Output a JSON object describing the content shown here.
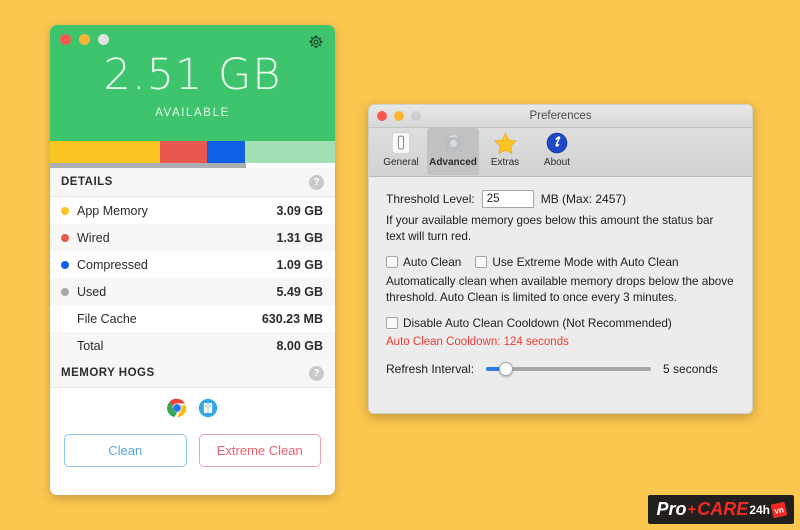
{
  "background_color": "#fbc74f",
  "memory_app": {
    "window_controls": [
      {
        "name": "close",
        "color": "#f9584f"
      },
      {
        "name": "minimize",
        "color": "#f8b633"
      },
      {
        "name": "zoom",
        "color": "#dfe2e0"
      }
    ],
    "settings_icon": "gear-icon",
    "header_bg": "#3ec46d",
    "available_value": "2.51 GB",
    "available_label": "AVAILABLE",
    "memory_bar": [
      {
        "name": "App Memory",
        "color": "#fac422",
        "percent": 38.6
      },
      {
        "name": "Wired",
        "color": "#e8584f",
        "percent": 16.4
      },
      {
        "name": "Compressed",
        "color": "#1161e8",
        "percent": 13.6
      },
      {
        "name": "Free",
        "color": "#a4e0b5",
        "percent": 31.4
      }
    ],
    "details_section": {
      "title": "DETAILS",
      "help_label": "?",
      "rows": [
        {
          "label": "App Memory",
          "value": "3.09 GB",
          "dot_color": "#fac422"
        },
        {
          "label": "Wired",
          "value": "1.31 GB",
          "dot_color": "#e8584f"
        },
        {
          "label": "Compressed",
          "value": "1.09 GB",
          "dot_color": "#1161e8"
        },
        {
          "label": "Used",
          "value": "5.49 GB",
          "dot_color": "#a8a8a8"
        },
        {
          "label": "File Cache",
          "value": "630.23 MB",
          "dot_color": ""
        },
        {
          "label": "Total",
          "value": "8.00 GB",
          "dot_color": ""
        }
      ]
    },
    "memory_hogs_section": {
      "title": "MEMORY HOGS",
      "help_label": "?",
      "apps": [
        "chrome-icon",
        "dictionary-icon"
      ]
    },
    "buttons": {
      "clean_label": "Clean",
      "extreme_clean_label": "Extreme Clean",
      "clean_accent": "#5aa6e0",
      "extreme_accent": "#ed5f6e"
    }
  },
  "preferences": {
    "title": "Preferences",
    "window_controls": [
      {
        "name": "close",
        "color": "#f9584f"
      },
      {
        "name": "minimize",
        "color": "#f8b633"
      },
      {
        "name": "zoom",
        "color": "#cfcfcf"
      }
    ],
    "tabs": [
      {
        "label": "General",
        "icon": "phone-icon",
        "selected": false
      },
      {
        "label": "Advanced",
        "icon": "gear-icon",
        "selected": true
      },
      {
        "label": "Extras",
        "icon": "star-icon",
        "selected": false
      },
      {
        "label": "About",
        "icon": "info-icon",
        "selected": false
      }
    ],
    "threshold": {
      "label": "Threshold Level:",
      "value": "25",
      "unit_note": "MB (Max: 2457)",
      "description": "If your available memory goes below this amount the status bar text will turn red."
    },
    "auto_clean": {
      "checkbox_label": "Auto Clean",
      "checked": false,
      "extreme_mode_label": "Use Extreme Mode with Auto Clean",
      "extreme_mode_checked": false,
      "description": "Automatically clean when available memory drops below the above threshold. Auto Clean is limited to once every 3 minutes."
    },
    "cooldown": {
      "checkbox_label": "Disable Auto Clean Cooldown (Not Recommended)",
      "checked": false,
      "status_text": "Auto Clean Cooldown: 124 seconds",
      "status_color": "#ef3b34"
    },
    "refresh": {
      "label": "Refresh Interval:",
      "value_text": "5 seconds",
      "slider_percent": 11,
      "accent": "#2b7fe8"
    }
  },
  "watermark": {
    "pro": "Pro",
    "plus": "+",
    "care": "CARE",
    "suffix": "24h",
    "tld": "vn"
  }
}
